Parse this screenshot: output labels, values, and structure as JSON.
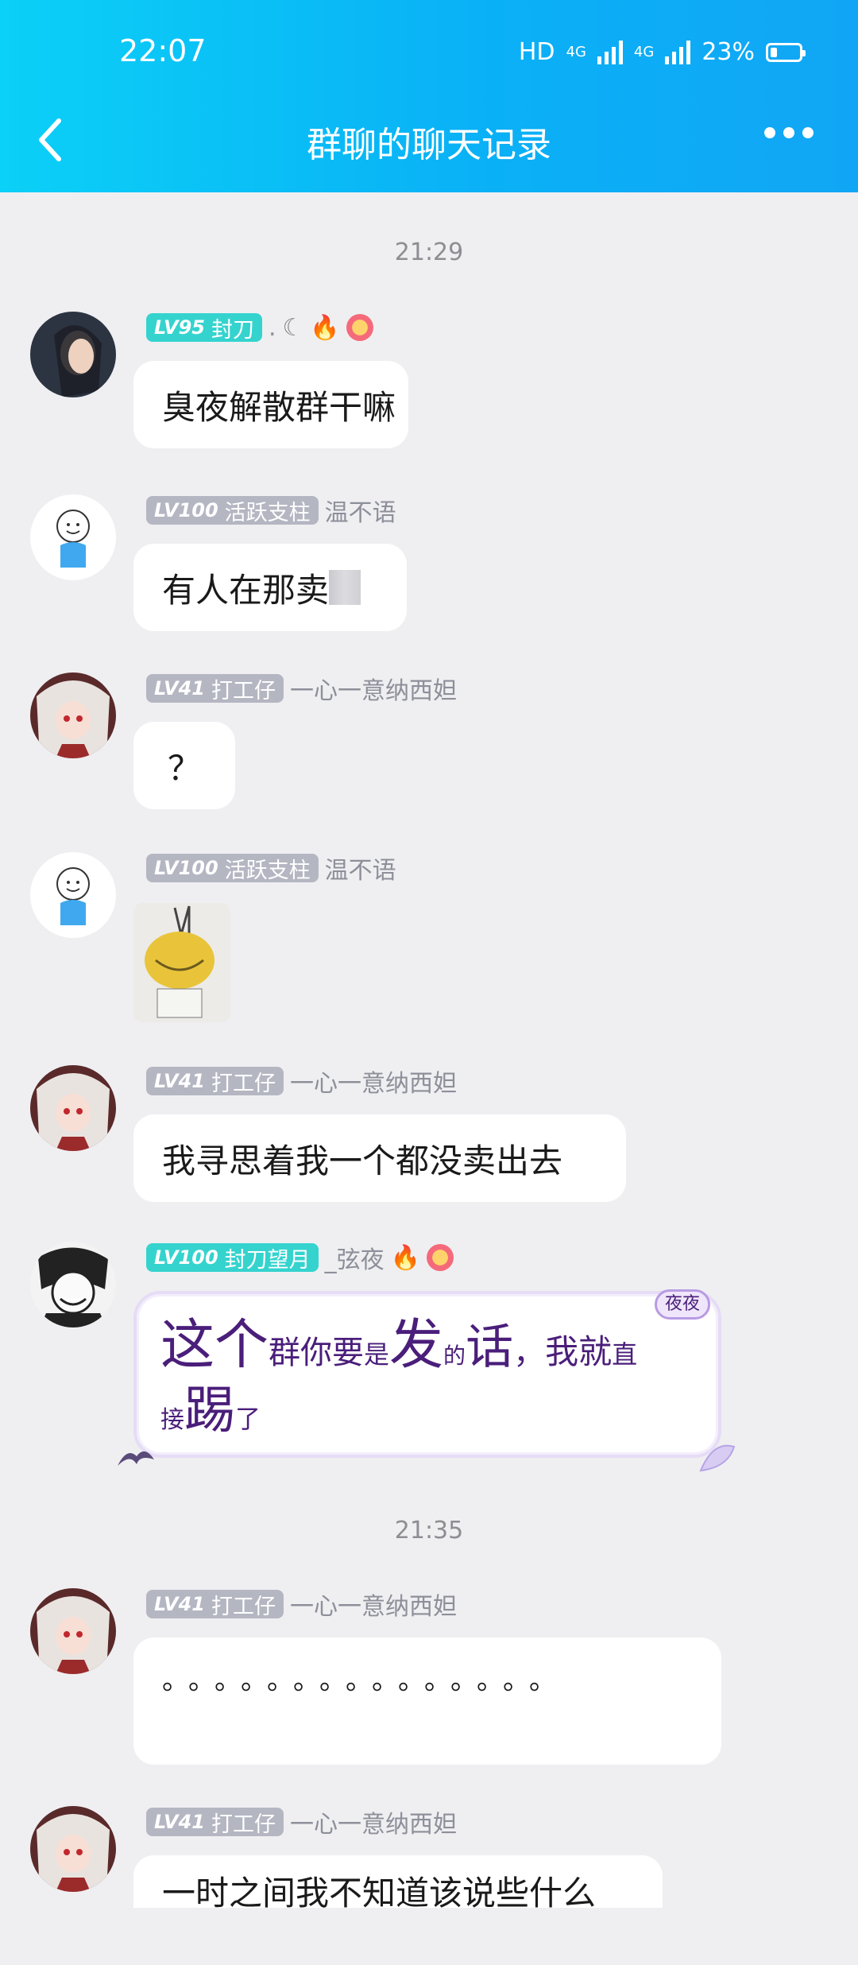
{
  "status_bar": {
    "time": "22:07",
    "hd": "HD",
    "net1": "4G",
    "net2": "4G",
    "battery": "23%",
    "battery_level": 0.23
  },
  "header": {
    "title": "群聊的聊天记录"
  },
  "separators": {
    "first": "21:29",
    "second": "21:35"
  },
  "messages": [
    {
      "level": "LV95",
      "role": "封刀",
      "nick": ".",
      "text_a": "臭",
      "text_b": "夜解散群干嘛"
    },
    {
      "level": "LV100",
      "role": "活跃支柱",
      "nick": "温不语",
      "text": "有人在那卖"
    },
    {
      "level": "LV41",
      "role": "打工仔",
      "nick": "一心一意纳西妲",
      "text": "？"
    },
    {
      "level": "LV100",
      "role": "活跃支柱",
      "nick": "温不语"
    },
    {
      "level": "LV41",
      "role": "打工仔",
      "nick": "一心一意纳西妲",
      "text": "我寻思着我一个都没卖出去"
    },
    {
      "level": "LV100",
      "role": "封刀望月",
      "nick": "_弦夜",
      "tag": "夜夜",
      "p1": "这个",
      "p2": "群你要",
      "p3": "是",
      "p4": "发",
      "p5": "的",
      "p6": "话",
      "p7": "，",
      "p8": "我就",
      "p9": "直",
      "p10": "接",
      "p11": "踢",
      "p12": "了"
    },
    {
      "level": "LV41",
      "role": "打工仔",
      "nick": "一心一意纳西妲",
      "text": "。。。。。。。。。。。。。。。"
    },
    {
      "level": "LV41",
      "role": "打工仔",
      "nick": "一心一意纳西妲",
      "text": "一时之间我不知道该说些什么"
    }
  ]
}
